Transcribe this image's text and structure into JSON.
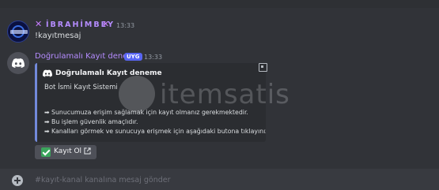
{
  "message1": {
    "username": "İBRAHİMBEY",
    "deco_left": "✕",
    "deco_right": "✕",
    "timestamp": "13:33",
    "text": "!kayıtmesaj"
  },
  "message2": {
    "username": "Doğrulamalı Kayıt deneme",
    "badge": "UYG",
    "timestamp": "13:33",
    "embed": {
      "author": "Doğrulamalı Kayıt deneme",
      "title": "Bot İsmi Kayıt Sistemi",
      "lines": [
        "➡ Sunucumuza erişim sağlamak için kayıt olmanız gerekmektedir.",
        "➡ Bu işlem güvenlik amaçlıdır.",
        "➡ Kanalları görmek ve sunucuya erişmek için aşağıdaki butona tıklayınız."
      ],
      "accent_color": "#7289da"
    },
    "button_label": "Kayıt Ol"
  },
  "watermark": {
    "text": "itemsatis"
  },
  "input": {
    "placeholder": "#kayıt-kanal kanalına mesaj gönder"
  },
  "icons": {
    "avatar2": "discord-icon",
    "author": "discord-icon",
    "button_check": "check-icon",
    "button_ext": "external-link-icon",
    "add": "plus-circle-icon"
  }
}
